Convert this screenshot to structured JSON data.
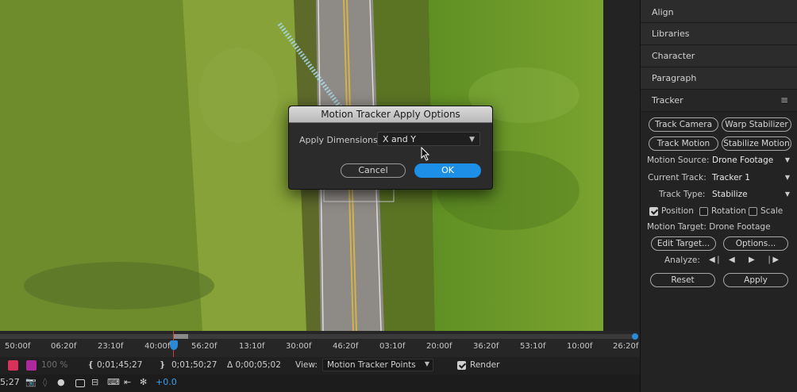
{
  "dialog": {
    "title": "Motion Tracker Apply Options",
    "apply_dimensions_label": "Apply Dimensions:",
    "apply_dimensions_value": "X and Y",
    "cancel_label": "Cancel",
    "ok_label": "OK"
  },
  "panels": {
    "align": "Align",
    "libraries": "Libraries",
    "character": "Character",
    "paragraph": "Paragraph",
    "tracker": "Tracker"
  },
  "tracker": {
    "track_camera": "Track Camera",
    "warp_stabilizer": "Warp Stabilizer",
    "track_motion": "Track Motion",
    "stabilize_motion": "Stabilize Motion",
    "motion_source_label": "Motion Source:",
    "motion_source_value": "Drone Footage",
    "current_track_label": "Current Track:",
    "current_track_value": "Tracker 1",
    "track_type_label": "Track Type:",
    "track_type_value": "Stabilize",
    "position_label": "Position",
    "position_checked": true,
    "rotation_label": "Rotation",
    "rotation_checked": false,
    "scale_label": "Scale",
    "scale_checked": false,
    "motion_target": "Motion Target: Drone Footage",
    "edit_target": "Edit Target...",
    "options": "Options...",
    "analyze_label": "Analyze:",
    "reset": "Reset",
    "apply": "Apply"
  },
  "timeline": {
    "ticks": [
      "50:00f",
      "06:20f",
      "23:10f",
      "40:00f",
      "56:20f",
      "13:10f",
      "30:00f",
      "46:20f",
      "03:10f",
      "20:00f",
      "36:20f",
      "53:10f",
      "10:00f",
      "26:20f"
    ]
  },
  "statusbar": {
    "zoom": "100 %",
    "in_time": "0;01;45;27",
    "out_time": "0;01;50;27",
    "duration": "Δ 0;00;05;02",
    "view_label": "View:",
    "view_value": "Motion Tracker Points",
    "render_label": "Render",
    "render_checked": true
  },
  "toolbar": {
    "timecode_fragment": "5;27",
    "exposure": "+0.0"
  },
  "colors": {
    "accent": "#1e8fe6",
    "swatch_red": "#d8325a",
    "swatch_magenta": "#b0289e",
    "grass": "#6c8a2c",
    "road": "#8e8a86"
  }
}
